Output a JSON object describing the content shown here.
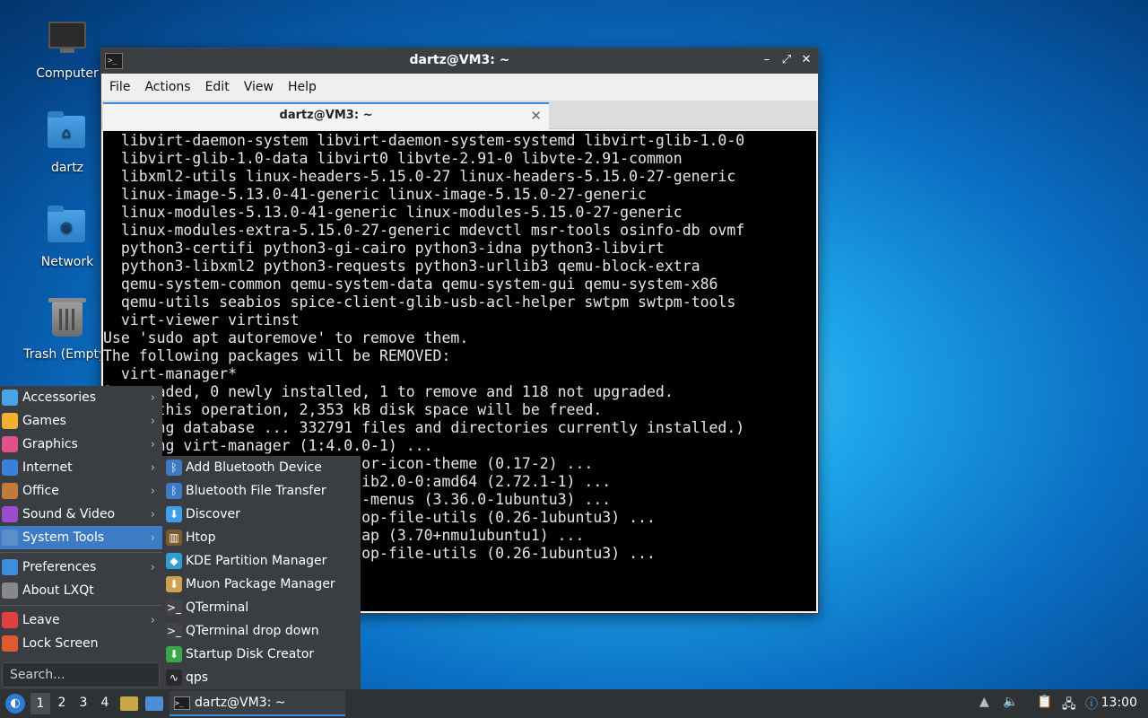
{
  "desktop": {
    "icons": [
      {
        "label": "Computer"
      },
      {
        "label": "dartz"
      },
      {
        "label": "Network"
      },
      {
        "label": "Trash (Empty)"
      }
    ]
  },
  "window": {
    "title": "dartz@VM3: ~",
    "menus": [
      "File",
      "Actions",
      "Edit",
      "View",
      "Help"
    ],
    "tab_label": "dartz@VM3: ~",
    "terminal_lines": [
      "  libvirt-daemon-system libvirt-daemon-system-systemd libvirt-glib-1.0-0",
      "  libvirt-glib-1.0-data libvirt0 libvte-2.91-0 libvte-2.91-common",
      "  libxml2-utils linux-headers-5.15.0-27 linux-headers-5.15.0-27-generic",
      "  linux-image-5.13.0-41-generic linux-image-5.15.0-27-generic",
      "  linux-modules-5.13.0-41-generic linux-modules-5.15.0-27-generic",
      "  linux-modules-extra-5.15.0-27-generic mdevctl msr-tools osinfo-db ovmf",
      "  python3-certifi python3-gi-cairo python3-idna python3-libvirt",
      "  python3-libxml2 python3-requests python3-urllib3 qemu-block-extra",
      "  qemu-system-common qemu-system-data qemu-system-gui qemu-system-x86",
      "  qemu-utils seabios spice-client-glib-usb-acl-helper swtpm swtpm-tools",
      "  virt-viewer virtinst",
      "Use 'sudo apt autoremove' to remove them.",
      "The following packages will be REMOVED:",
      "  virt-manager*",
      "0 upgraded, 0 newly installed, 1 to remove and 118 not upgraded.",
      "After this operation, 2,353 kB disk space will be freed.",
      "(Reading database ... 332791 files and directories currently installed.)",
      "Removing virt-manager (1:4.0.0-1) ...",
      "Processing triggers for hicolor-icon-theme (0.17-2) ...",
      "Processing triggers for libglib2.0-0:amd64 (2.72.1-1) ...",
      "Processing triggers for gnome-menus (3.36.0-1ubuntu3) ...",
      "Processing triggers for desktop-file-utils (0.26-1ubuntu3) ...",
      "Processing triggers for mailcap (3.70+nmu1ubuntu1) ...",
      "Processing triggers for desktop-file-utils (0.26-1ubuntu3) ..."
    ]
  },
  "start_menu": {
    "categories": [
      {
        "label": "Accessories",
        "icon": "accessories-icon",
        "color": "#4aa3e6"
      },
      {
        "label": "Games",
        "icon": "games-icon",
        "color": "#f0b030"
      },
      {
        "label": "Graphics",
        "icon": "graphics-icon",
        "color": "#e0508a"
      },
      {
        "label": "Internet",
        "icon": "internet-icon",
        "color": "#3a7fd8"
      },
      {
        "label": "Office",
        "icon": "office-icon",
        "color": "#c07a3a"
      },
      {
        "label": "Sound & Video",
        "icon": "sound-video-icon",
        "color": "#9a4cd0"
      },
      {
        "label": "System Tools",
        "icon": "system-tools-icon",
        "color": "#5a8fc8"
      }
    ],
    "settings": [
      {
        "label": "Preferences",
        "icon": "preferences-icon",
        "color": "#3a8fe0"
      },
      {
        "label": "About LXQt",
        "icon": "about-icon",
        "color": "#888888"
      }
    ],
    "session": [
      {
        "label": "Leave",
        "icon": "leave-icon",
        "color": "#e04040"
      },
      {
        "label": "Lock Screen",
        "icon": "lock-icon",
        "color": "#e05a30"
      }
    ],
    "search_placeholder": "Search..."
  },
  "submenu": {
    "items": [
      {
        "label": "Add Bluetooth Device",
        "icon": "bluetooth-icon"
      },
      {
        "label": "Bluetooth File Transfer",
        "icon": "bluetooth-icon"
      },
      {
        "label": "Discover",
        "icon": "discover-icon"
      },
      {
        "label": "Htop",
        "icon": "htop-icon"
      },
      {
        "label": "KDE Partition Manager",
        "icon": "partition-manager-icon"
      },
      {
        "label": "Muon Package Manager",
        "icon": "package-manager-icon"
      },
      {
        "label": "QTerminal",
        "icon": "terminal-icon"
      },
      {
        "label": "QTerminal drop down",
        "icon": "terminal-icon"
      },
      {
        "label": "Startup Disk Creator",
        "icon": "startup-disk-icon"
      },
      {
        "label": "qps",
        "icon": "qps-icon"
      }
    ]
  },
  "taskbar": {
    "workspaces": [
      "1",
      "2",
      "3",
      "4"
    ],
    "task_label": "dartz@VM3: ~",
    "clock": "13:00"
  },
  "colors": {
    "accent": "#3d8be0",
    "menu_bg": "#3a3d41",
    "selected": "#3d7cc4"
  }
}
